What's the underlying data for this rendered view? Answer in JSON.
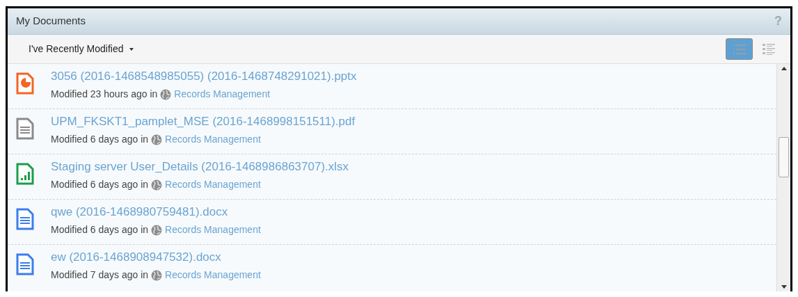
{
  "panel": {
    "title": "My Documents",
    "help": "?"
  },
  "toolbar": {
    "filter": "I've Recently Modified",
    "views": [
      {
        "kind": "simple",
        "selected": true
      },
      {
        "kind": "detailed",
        "selected": false
      }
    ]
  },
  "documents": [
    {
      "kind": "presentation",
      "name": "3056 (2016-1468548985055) (2016-1468748291021).pptx",
      "modified": "Modified 23 hours ago in",
      "site": "Records Management"
    },
    {
      "kind": "generic",
      "name": "UPM_FKSKT1_pamplet_MSE (2016-1468998151511).pdf",
      "modified": "Modified 6 days ago in",
      "site": "Records Management"
    },
    {
      "kind": "spreadsheet",
      "name": "Staging server User_Details (2016-1468986863707).xlsx",
      "modified": "Modified 6 days ago in",
      "site": "Records Management"
    },
    {
      "kind": "document",
      "name": "qwe (2016-1468980759481).docx",
      "modified": "Modified 6 days ago in",
      "site": "Records Management"
    },
    {
      "kind": "document",
      "name": "ew (2016-1468908947532).docx",
      "modified": "Modified 7 days ago in",
      "site": "Records Management"
    }
  ]
}
